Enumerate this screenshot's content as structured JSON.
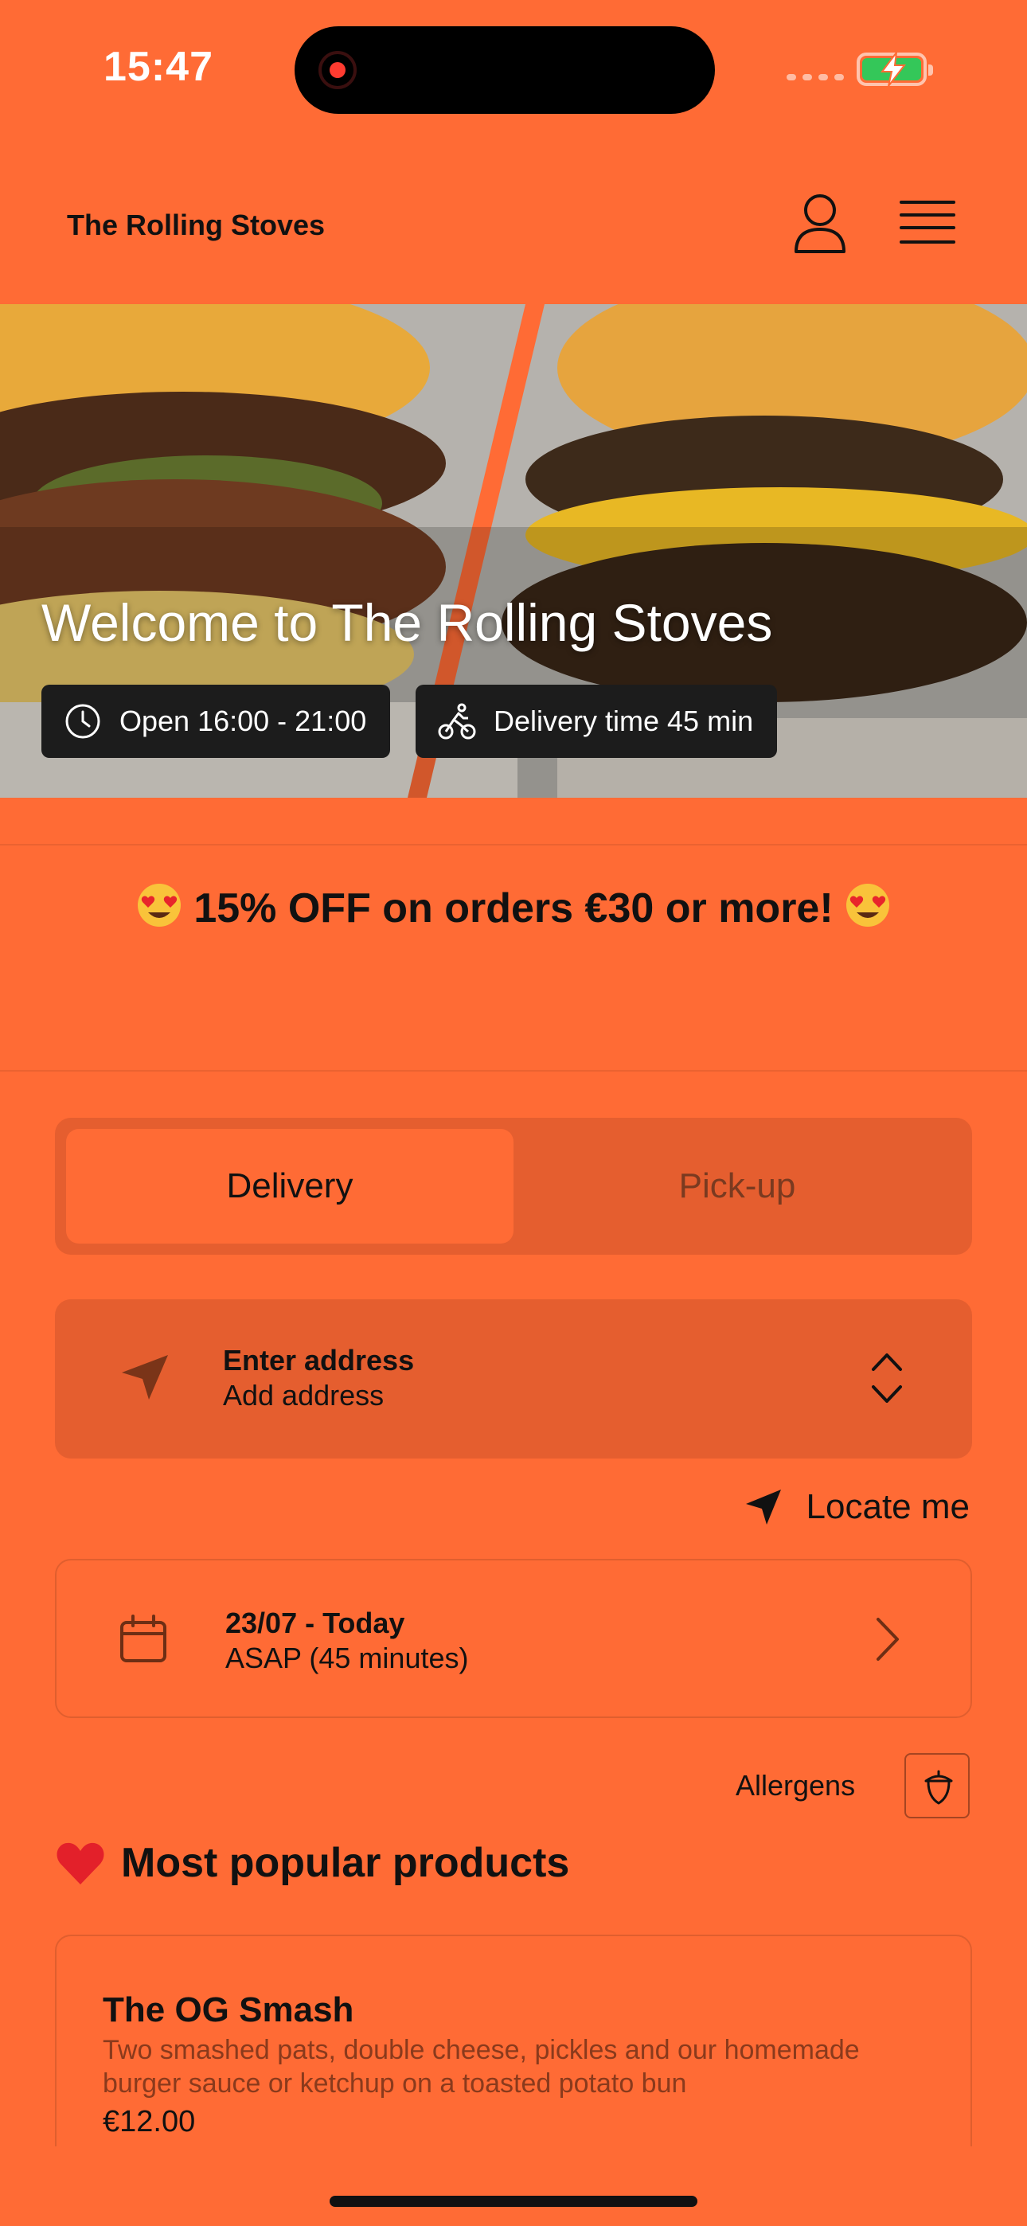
{
  "status_bar": {
    "time": "15:47"
  },
  "header": {
    "brand": "The Rolling Stoves",
    "user_icon": "user-icon",
    "menu_icon": "hamburger-menu-icon"
  },
  "hero": {
    "title": "Welcome to The Rolling Stoves",
    "hours_chip": "Open 16:00 - 21:00",
    "delivery_chip": "Delivery time 45 min"
  },
  "promo": {
    "text": "15% OFF on orders €30 or more!"
  },
  "order_mode": {
    "options": [
      "Delivery",
      "Pick-up"
    ],
    "selected": "Delivery"
  },
  "address": {
    "title": "Enter address",
    "subtitle": "Add address"
  },
  "locate": {
    "label": "Locate me"
  },
  "schedule": {
    "date": "23/07 - Today",
    "time": "ASAP (45 minutes)"
  },
  "allergens": {
    "label": "Allergens"
  },
  "popular": {
    "title": "Most popular products"
  },
  "products": [
    {
      "name": "The OG Smash",
      "description": "Two smashed pats, double cheese, pickles and our homemade burger sauce or ketchup on a toasted potato bun",
      "price": "€12.00"
    }
  ],
  "colors": {
    "background": "#ff6b35",
    "card": "#e55e2f",
    "chip": "#1c1c1c",
    "text": "#111111"
  }
}
